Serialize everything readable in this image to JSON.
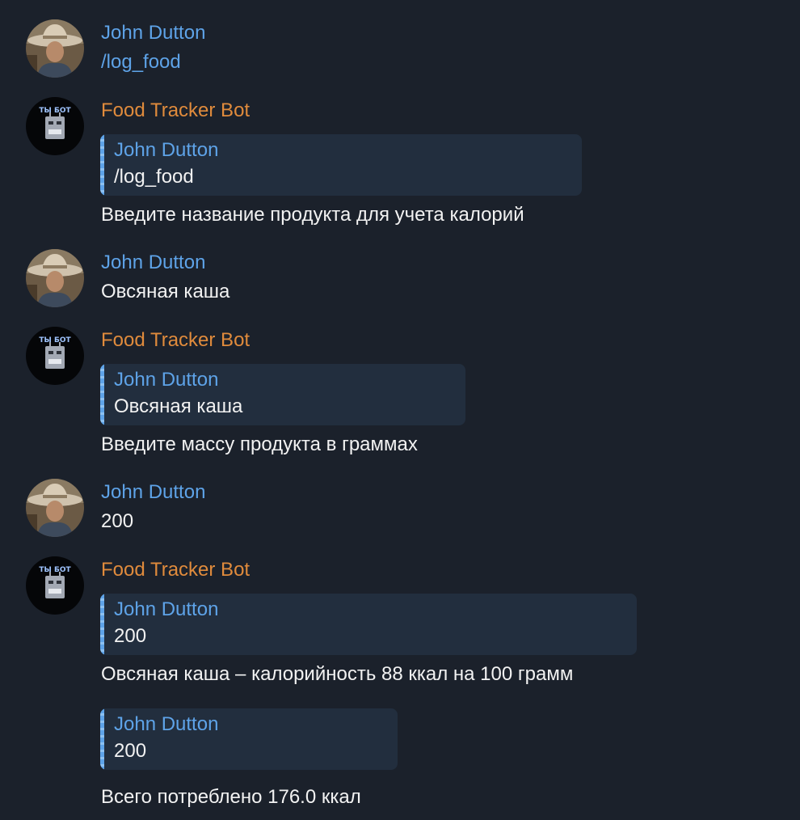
{
  "user": {
    "name": "John Dutton",
    "avatar_icon": "cowboy-photo-avatar"
  },
  "bot": {
    "name": "Food Tracker Bot",
    "avatar_text": "ТЫ БОТ",
    "avatar_icon": "robot-avatar"
  },
  "messages": [
    {
      "text": "/log_food"
    },
    {
      "quote_name": "John Dutton",
      "quote_text": "/log_food",
      "text": "Введите название продукта для учета калорий"
    },
    {
      "text": "Овсяная каша"
    },
    {
      "quote_name": "John Dutton",
      "quote_text": "Овсяная каша",
      "text": "Введите массу продукта в граммах"
    },
    {
      "text": "200"
    },
    {
      "quote_name": "John Dutton",
      "quote_text": "200",
      "text": "Овсяная каша – калорийность 88 ккал на 100 грамм"
    },
    {
      "quote_name": "John Dutton",
      "quote_text": "200",
      "text": "Всего потреблено 176.0 ккал"
    }
  ],
  "colors": {
    "background": "#1b212b",
    "user_name": "#5ea3e8",
    "bot_name": "#e08b3c",
    "quote_background": "#222e3e",
    "text": "#f2f2f2"
  }
}
